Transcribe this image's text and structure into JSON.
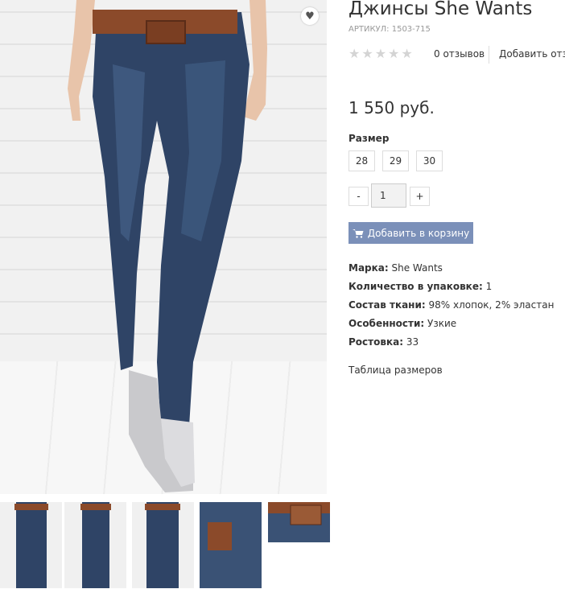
{
  "product": {
    "title": "Джинсы She Wants",
    "sku": "АРТИКУЛ: 1503-715",
    "price": "1 550 руб.",
    "rating_stars": 0,
    "rating_max": 5,
    "reviews_label": "0 отзывов",
    "add_review_label": "Добавить отзыв"
  },
  "size": {
    "label": "Размер",
    "options": [
      "28",
      "29",
      "30"
    ]
  },
  "quantity": {
    "minus": "-",
    "value": "1",
    "plus": "+"
  },
  "cart": {
    "label": "Добавить в корзину",
    "icon": "shopping-cart-icon"
  },
  "attributes": [
    {
      "key": "Марка:",
      "value": "She Wants"
    },
    {
      "key": "Количество в упаковке:",
      "value": "1"
    },
    {
      "key": "Состав ткани:",
      "value": "98% хлопок, 2% эластан"
    },
    {
      "key": "Особенности:",
      "value": "Узкие"
    },
    {
      "key": "Ростовка:",
      "value": "33"
    }
  ],
  "size_table_link": "Таблица размеров",
  "colors": {
    "cart_button": "#7b90b9",
    "denim": "#2f4466",
    "belt": "#8b4a2a",
    "star_empty": "#d4d4d4"
  }
}
